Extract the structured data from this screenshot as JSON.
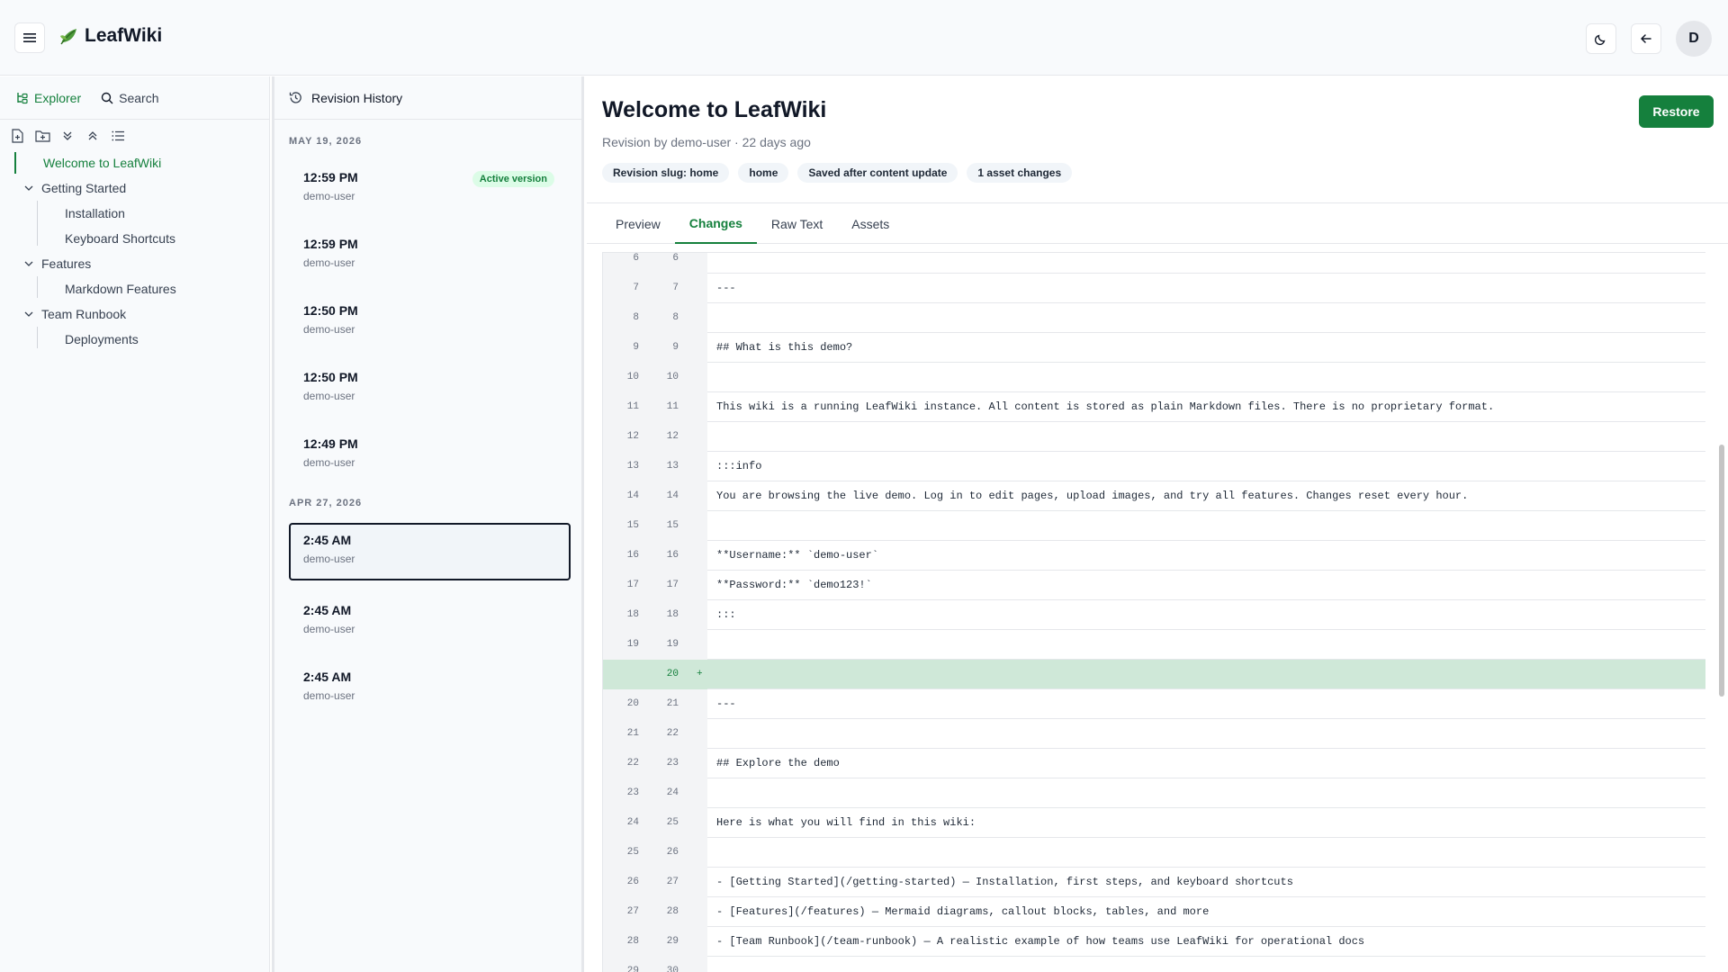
{
  "app": {
    "title": "LeafWiki"
  },
  "header": {
    "avatar_initial": "D"
  },
  "sidebar": {
    "tabs": [
      {
        "label": "Explorer"
      },
      {
        "label": "Search"
      }
    ],
    "tree": [
      {
        "label": "Welcome to LeafWiki",
        "level": 0,
        "active": true
      },
      {
        "label": "Getting Started",
        "level": 0,
        "expanded": true
      },
      {
        "label": "Installation",
        "level": 1
      },
      {
        "label": "Keyboard Shortcuts",
        "level": 1
      },
      {
        "label": "Features",
        "level": 0,
        "expanded": true
      },
      {
        "label": "Markdown Features",
        "level": 1
      },
      {
        "label": "Team Runbook",
        "level": 0,
        "expanded": true
      },
      {
        "label": "Deployments",
        "level": 1
      }
    ]
  },
  "revisions": {
    "header": "Revision History",
    "groups": [
      {
        "date": "MAY 19, 2026",
        "items": [
          {
            "time": "12:59 PM",
            "user": "demo-user",
            "badge": "Active version"
          },
          {
            "time": "12:59 PM",
            "user": "demo-user"
          },
          {
            "time": "12:50 PM",
            "user": "demo-user"
          },
          {
            "time": "12:50 PM",
            "user": "demo-user"
          },
          {
            "time": "12:49 PM",
            "user": "demo-user"
          }
        ]
      },
      {
        "date": "APR 27, 2026",
        "items": [
          {
            "time": "2:45 AM",
            "user": "demo-user",
            "selected": true
          },
          {
            "time": "2:45 AM",
            "user": "demo-user"
          },
          {
            "time": "2:45 AM",
            "user": "demo-user"
          }
        ]
      }
    ]
  },
  "main": {
    "title": "Welcome to LeafWiki",
    "meta": "Revision by demo-user · 22 days ago",
    "chips": [
      "Revision slug: home",
      "home",
      "Saved after content update",
      "1 asset changes"
    ],
    "restore_label": "Restore",
    "tabs": [
      {
        "label": "Preview"
      },
      {
        "label": "Changes",
        "active": true
      },
      {
        "label": "Raw Text"
      },
      {
        "label": "Assets"
      }
    ]
  },
  "diff": [
    {
      "old": "6",
      "new": "6",
      "text": ""
    },
    {
      "old": "7",
      "new": "7",
      "text": "---"
    },
    {
      "old": "8",
      "new": "8",
      "text": ""
    },
    {
      "old": "9",
      "new": "9",
      "text": "## What is this demo?"
    },
    {
      "old": "10",
      "new": "10",
      "text": ""
    },
    {
      "old": "11",
      "new": "11",
      "text": "This wiki is a running LeafWiki instance. All content is stored as plain Markdown files. There is no proprietary format."
    },
    {
      "old": "12",
      "new": "12",
      "text": ""
    },
    {
      "old": "13",
      "new": "13",
      "text": ":::info"
    },
    {
      "old": "14",
      "new": "14",
      "text": "You are browsing the live demo. Log in to edit pages, upload images, and try all features. Changes reset every hour."
    },
    {
      "old": "15",
      "new": "15",
      "text": ""
    },
    {
      "old": "16",
      "new": "16",
      "text": "**Username:** `demo-user`"
    },
    {
      "old": "17",
      "new": "17",
      "text": "**Password:** `demo123!`"
    },
    {
      "old": "18",
      "new": "18",
      "text": ":::"
    },
    {
      "old": "19",
      "new": "19",
      "text": ""
    },
    {
      "old": "",
      "new": "20",
      "text": "",
      "sign": "+",
      "added": true
    },
    {
      "old": "20",
      "new": "21",
      "text": "---"
    },
    {
      "old": "21",
      "new": "22",
      "text": ""
    },
    {
      "old": "22",
      "new": "23",
      "text": "## Explore the demo"
    },
    {
      "old": "23",
      "new": "24",
      "text": ""
    },
    {
      "old": "24",
      "new": "25",
      "text": "Here is what you will find in this wiki:"
    },
    {
      "old": "25",
      "new": "26",
      "text": ""
    },
    {
      "old": "26",
      "new": "27",
      "text": "- [Getting Started](/getting-started) — Installation, first steps, and keyboard shortcuts"
    },
    {
      "old": "27",
      "new": "28",
      "text": "- [Features](/features) — Mermaid diagrams, callout blocks, tables, and more"
    },
    {
      "old": "28",
      "new": "29",
      "text": "- [Team Runbook](/team-runbook) — A realistic example of how teams use LeafWiki for operational docs"
    },
    {
      "old": "29",
      "new": "30",
      "text": ""
    }
  ],
  "colors": {
    "accent": "#15803d",
    "added_bg": "#cfe8d8"
  },
  "icons": {
    "menu": "hamburger-icon",
    "logo": "leaf-icon",
    "theme": "moon-icon",
    "back": "arrow-left-icon",
    "explorer": "tree-icon",
    "search": "search-icon",
    "history": "history-icon"
  }
}
